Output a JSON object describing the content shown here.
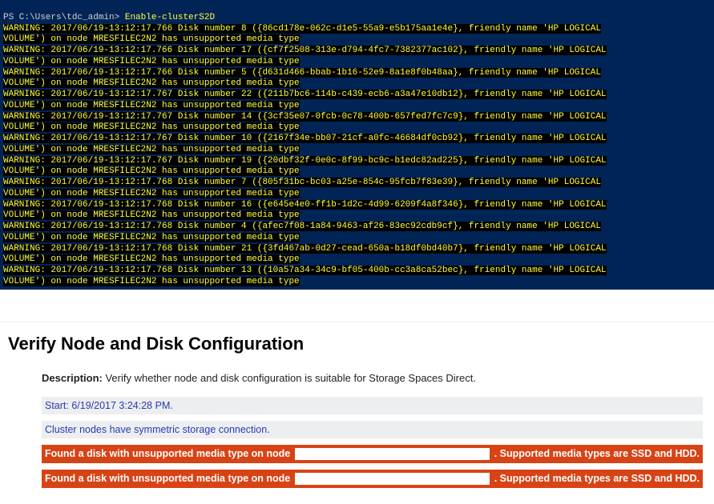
{
  "terminal": {
    "prompt_path": "PS C:\\Users\\tdc_admin>",
    "prompt_cmd": "Enable-clusterS2D",
    "node": "MRESFILEC2N2",
    "friendly_name": "'HP LOGICAL VOLUME'",
    "tail": "has unsupported media type",
    "entries": [
      {
        "ts": "2017/06/19-13:12:17.766",
        "disk": "8",
        "guid": "{86cd178e-062c-d1e5-55a9-e5b175aa1e4e}"
      },
      {
        "ts": "2017/06/19-13:12:17.766",
        "disk": "17",
        "guid": "{cf7f2508-313e-d794-4fc7-7382377ac102}"
      },
      {
        "ts": "2017/06/19-13:12:17.766",
        "disk": "5",
        "guid": "{d631d466-bbab-1b16-52e9-8a1e8f0b48aa}"
      },
      {
        "ts": "2017/06/19-13:12:17.767",
        "disk": "22",
        "guid": "{211b7bc6-114b-c439-ecb6-a3a47e10db12}"
      },
      {
        "ts": "2017/06/19-13:12:17.767",
        "disk": "14",
        "guid": "{3cf35e07-0fcb-0c78-400b-657fed7fc7c9}"
      },
      {
        "ts": "2017/06/19-13:12:17.767",
        "disk": "10",
        "guid": "{2167f34e-bb07-21cf-a0fc-46684df0cb92}"
      },
      {
        "ts": "2017/06/19-13:12:17.767",
        "disk": "19",
        "guid": "{20dbf32f-0e0c-8f99-bc9c-b1edc82ad225}"
      },
      {
        "ts": "2017/06/19-13:12:17.768",
        "disk": "7",
        "guid": "{805f31bc-bc03-a25e-854c-95fcb7f83e39}"
      },
      {
        "ts": "2017/06/19-13:12:17.768",
        "disk": "16",
        "guid": "{e645e4e0-ff1b-1d2c-4d99-6209f4a8f346}"
      },
      {
        "ts": "2017/06/19-13:12:17.768",
        "disk": "4",
        "guid": "{afec7f08-1a84-9463-af26-83ec92cdb9cf}"
      },
      {
        "ts": "2017/06/19-13:12:17.768",
        "disk": "21",
        "guid": "{3fd467ab-0d27-cead-650a-b18df0bd40b7}"
      },
      {
        "ts": "2017/06/19-13:12:17.768",
        "disk": "13",
        "guid": "{10a57a34-34c9-bf05-400b-cc3a8ca52bec}"
      }
    ]
  },
  "report": {
    "heading": "Verify Node and Disk Configuration",
    "description_label": "Description:",
    "description_text": "Verify whether node and disk configuration is suitable for Storage Spaces Direct.",
    "start": "Start: 6/19/2017 3:24:28 PM.",
    "symmetric": "Cluster nodes have symmetric storage connection.",
    "err_left": "Found a disk with unsupported media type on node",
    "err_right": ". Supported media types are SSD and HDD."
  }
}
